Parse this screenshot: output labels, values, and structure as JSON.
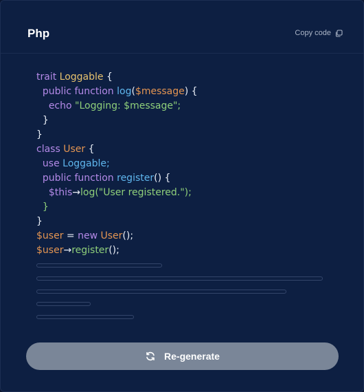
{
  "header": {
    "language": "Php",
    "copy_label": "Copy code",
    "copy_icon": "copy-icon"
  },
  "code": {
    "lines": [
      [
        [
          "kw",
          "trait "
        ],
        [
          "cls",
          "Loggable"
        ],
        [
          "pun",
          " {"
        ]
      ],
      [
        [
          "pun",
          "  "
        ],
        [
          "kw",
          "public function "
        ],
        [
          "fn",
          "log"
        ],
        [
          "pun",
          "("
        ],
        [
          "var",
          "$message"
        ],
        [
          "pun",
          ") {"
        ]
      ],
      [
        [
          "pun",
          "    "
        ],
        [
          "kw",
          "echo "
        ],
        [
          "str",
          "\"Logging: $message\";"
        ]
      ],
      [
        [
          "pun",
          "  }"
        ]
      ],
      [
        [
          "pun",
          "}"
        ]
      ],
      [
        [
          "kw",
          "class "
        ],
        [
          "cls2",
          "User"
        ],
        [
          "pun",
          " {"
        ]
      ],
      [
        [
          "pun",
          "  "
        ],
        [
          "kw",
          "use "
        ],
        [
          "fn",
          "Loggable;"
        ]
      ],
      [
        [
          "pun",
          "  "
        ],
        [
          "kw",
          "public function "
        ],
        [
          "fn",
          "register"
        ],
        [
          "pun",
          "() {"
        ]
      ],
      [
        [
          "pun",
          "    "
        ],
        [
          "pur",
          "$this"
        ],
        [
          "pun",
          "→"
        ],
        [
          "grn",
          "log"
        ],
        [
          "str",
          "(\"User registered.\");"
        ]
      ],
      [
        [
          "pun",
          "  "
        ],
        [
          "grn",
          "}"
        ]
      ],
      [
        [
          "pun",
          "}"
        ]
      ],
      [
        [
          "var",
          "$user"
        ],
        [
          "pun",
          " = "
        ],
        [
          "kw",
          "new "
        ],
        [
          "cls2",
          "User"
        ],
        [
          "pun",
          "();"
        ]
      ],
      [
        [
          "var",
          "$user"
        ],
        [
          "pun",
          "→"
        ],
        [
          "grn",
          "register"
        ],
        [
          "pun",
          "();"
        ]
      ]
    ]
  },
  "regenerate": {
    "label": "Re-generate",
    "icon": "refresh-icon"
  },
  "colors": {
    "background": "#0d1f42",
    "button": "#7a8698",
    "keyword": "#b48ae8",
    "class": "#e7c26e",
    "function": "#5fb6ee",
    "variable": "#e49552",
    "string": "#8fcf7a"
  }
}
